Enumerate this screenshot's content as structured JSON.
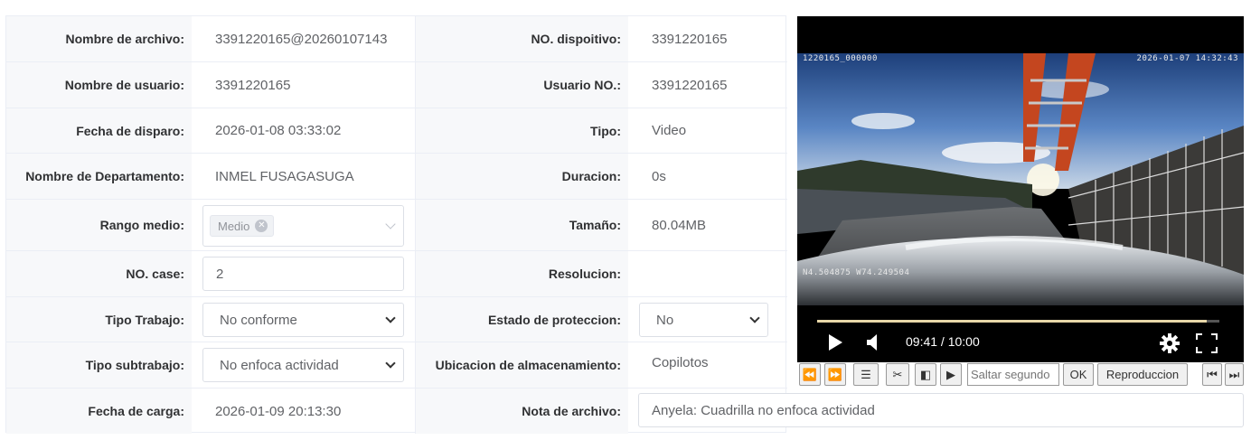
{
  "form": {
    "rows": [
      {
        "label1": "Nombre de archivo:",
        "value1": "3391220165@20260107143",
        "label2": "NO. dispoitivo:",
        "value2": "3391220165"
      },
      {
        "label1": "Nombre de usuario:",
        "value1": "3391220165",
        "label2": "Usuario NO.:",
        "value2": "3391220165"
      },
      {
        "label1": "Fecha de disparo:",
        "value1": "2026-01-08 03:33:02",
        "label2": "Tipo:",
        "value2": "Video"
      },
      {
        "label1": "Nombre de Departamento:",
        "value1": "INMEL FUSAGASUGA",
        "label2": "Duracion:",
        "value2": "0s"
      },
      {
        "label1": "Rango medio:",
        "value1": "",
        "label2": "Tamaño:",
        "value2": "80.04MB"
      },
      {
        "label1": "NO. case:",
        "value1": "2",
        "label2": "Resolucion:",
        "value2": ""
      },
      {
        "label1": "Tipo Trabajo:",
        "value1": "No conforme",
        "label2": "Estado de proteccion:",
        "value2": "No"
      },
      {
        "label1": "Tipo subtrabajo:",
        "value1": "No enfoca actividad",
        "label2": "Ubicacion de almacenamiento:",
        "value2": "Copilotos"
      },
      {
        "label1": "Fecha de carga:",
        "value1": "2026-01-09 20:13:30",
        "label2": "Nota de archivo:",
        "value2": "Anyela: Cuadrilla no enfoca actividad"
      }
    ],
    "rango_tag": "Medio"
  },
  "video": {
    "osd_top_left": "1220165_000000",
    "osd_top_right": "2026-01-07 14:32:43",
    "osd_bottom_left": "N4.504875 W74.249504",
    "time_display": "09:41 / 10:00",
    "progress": 0.968,
    "icons": {
      "play": "play-icon",
      "volume": "volume-icon",
      "settings": "gear-icon",
      "fullscreen": "fullscreen-icon"
    }
  },
  "toolbar": {
    "seek_placeholder": "Saltar segundo",
    "ok_label": "OK",
    "playback_label": "Reproduccion",
    "icons": [
      "rewind-icon",
      "fast-forward-icon",
      "list-icon",
      "scissors-icon",
      "prev-frame-icon",
      "next-frame-icon",
      "skip-start-icon",
      "skip-end-icon"
    ]
  }
}
